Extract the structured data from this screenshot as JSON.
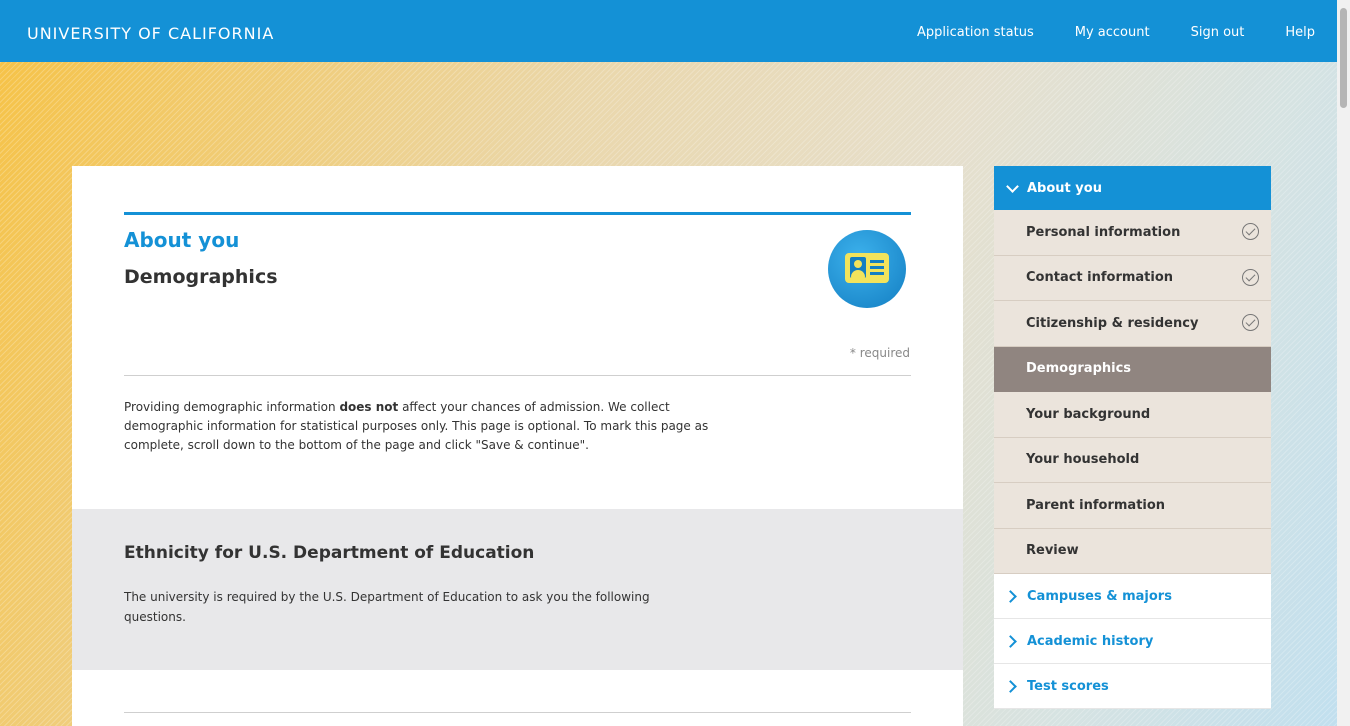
{
  "header": {
    "brand": "UNIVERSITY OF CALIFORNIA",
    "nav": [
      "Application status",
      "My account",
      "Sign out",
      "Help"
    ]
  },
  "main": {
    "section_title": "About you",
    "page_title": "Demographics",
    "required_note": "* required",
    "intro": {
      "before_bold": "Providing demographic information ",
      "bold": "does not",
      "after_bold": " affect your chances of admission. We collect demographic information for statistical purposes only. This page is optional. To mark this page as complete, scroll down to the bottom of the page and click \"Save & continue\"."
    },
    "ethnicity": {
      "title": "Ethnicity for U.S. Department of Education",
      "description": "The university is required by the U.S. Department of Education to ask you the following questions."
    }
  },
  "sidebar": {
    "open_section": "About you",
    "items": [
      {
        "label": "Personal information",
        "completed": true
      },
      {
        "label": "Contact information",
        "completed": true
      },
      {
        "label": "Citizenship & residency",
        "completed": true
      },
      {
        "label": "Demographics",
        "active": true
      },
      {
        "label": "Your background"
      },
      {
        "label": "Your household"
      },
      {
        "label": "Parent information"
      },
      {
        "label": "Review"
      }
    ],
    "sections": [
      "Campuses & majors",
      "Academic history",
      "Test scores"
    ]
  },
  "colors": {
    "brand_blue": "#1491d6",
    "active_item": "#908580",
    "item_bg": "#ebe4dc"
  },
  "icons": [
    "id-card-icon",
    "checkmark-circle-icon",
    "chevron-down-icon",
    "chevron-right-icon"
  ]
}
